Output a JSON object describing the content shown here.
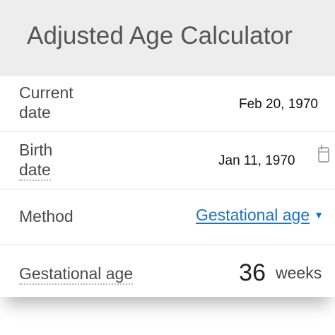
{
  "header": {
    "title": "Adjusted Age Calculator"
  },
  "current_date": {
    "label_line1": "Current",
    "label_line2": "date",
    "value": "Feb 20, 1970"
  },
  "birth_date": {
    "label_line1": "Birth",
    "label_line2": "date",
    "value": "Jan 11, 1970",
    "icon": "calendar-icon"
  },
  "method": {
    "label": "Method",
    "selected": "Gestational age",
    "arrow": "▼"
  },
  "gestational_age": {
    "label": "Gestational age",
    "value": "36",
    "unit": "weeks"
  },
  "colors": {
    "header_bg": "#ededed",
    "link": "#1a73c8",
    "label_text": "#4a4a4a"
  }
}
